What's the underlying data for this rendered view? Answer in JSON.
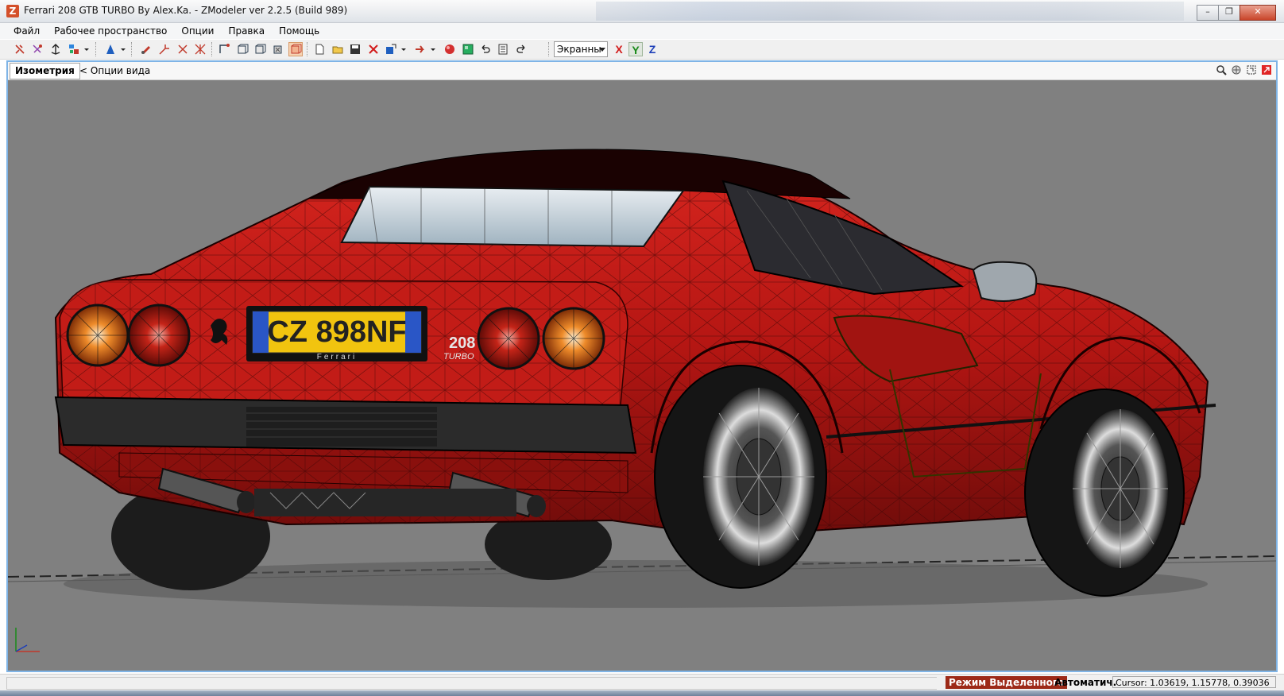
{
  "window": {
    "title": "Ferrari 208 GTB TURBO By Alex.Ka. - ZModeler ver 2.2.5 (Build 989)",
    "app_icon_letter": "Z",
    "buttons": {
      "minimize": "–",
      "restore": "❐",
      "close": "✕"
    }
  },
  "menu": {
    "items": [
      "Файл",
      "Рабочее пространство",
      "Опции",
      "Правка",
      "Помощь"
    ]
  },
  "toolbar": {
    "view_mode": "Экранны",
    "axis_x": "X",
    "axis_y": "Y",
    "axis_z": "Z",
    "colors": {
      "x": "#d21b1b",
      "y": "#1a8a1a",
      "z": "#1d3fb8"
    }
  },
  "viewport": {
    "tab_label": "Изометрия",
    "options_label": "<   Опции вида",
    "background": "#808080"
  },
  "scene": {
    "plate_text": "CZ 898NF",
    "badge_text": "208",
    "badge_sub": "TURBO",
    "plate_brand": "Ferrari",
    "car_color": "#c11a16"
  },
  "statusbar": {
    "mode": "Режим Выделенного",
    "auto": "Автоматич.",
    "cursor": "Cursor: 1.03619, 1.15778, 0.39036"
  }
}
